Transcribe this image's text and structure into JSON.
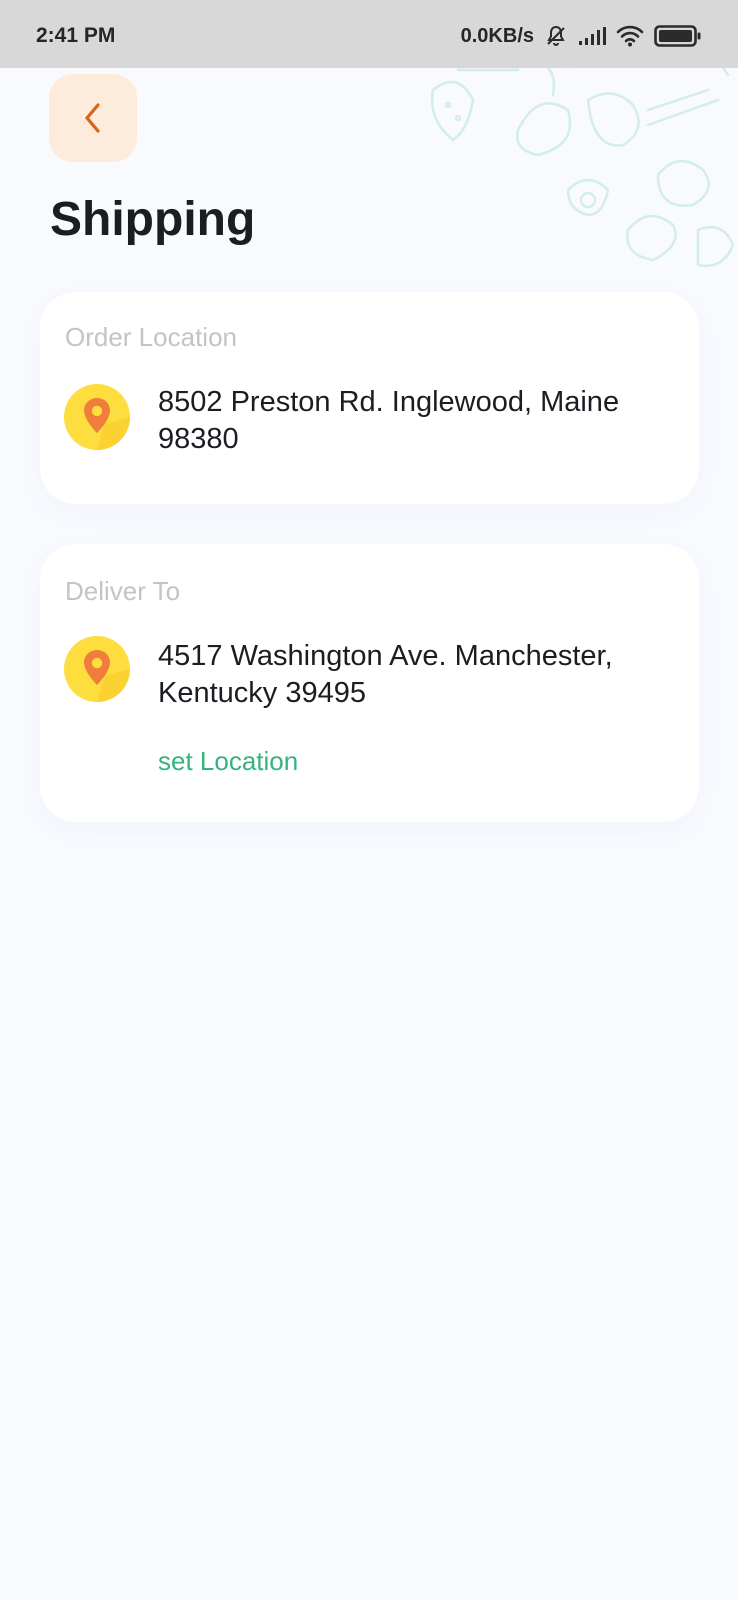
{
  "status_bar": {
    "time": "2:41 PM",
    "network_speed": "0.0KB/s",
    "icons": [
      "mute-icon",
      "signal-icon",
      "wifi-icon",
      "battery-icon"
    ]
  },
  "header": {
    "back_icon": "chevron-left-icon",
    "title": "Shipping"
  },
  "order_location": {
    "label": "Order Location",
    "icon": "map-pin-icon",
    "address": "8502 Preston Rd. Inglewood, Maine 98380"
  },
  "deliver_to": {
    "label": "Deliver To",
    "icon": "map-pin-icon",
    "address": "4517 Washington Ave. Manchester, Kentucky 39495",
    "action_label": "set Location"
  },
  "colors": {
    "accent_green": "#36B37E",
    "back_button_bg": "#FDEBDC",
    "back_icon": "#DA6317",
    "pin_bg": "#FEDD3F",
    "pin": "#F07D3B"
  }
}
